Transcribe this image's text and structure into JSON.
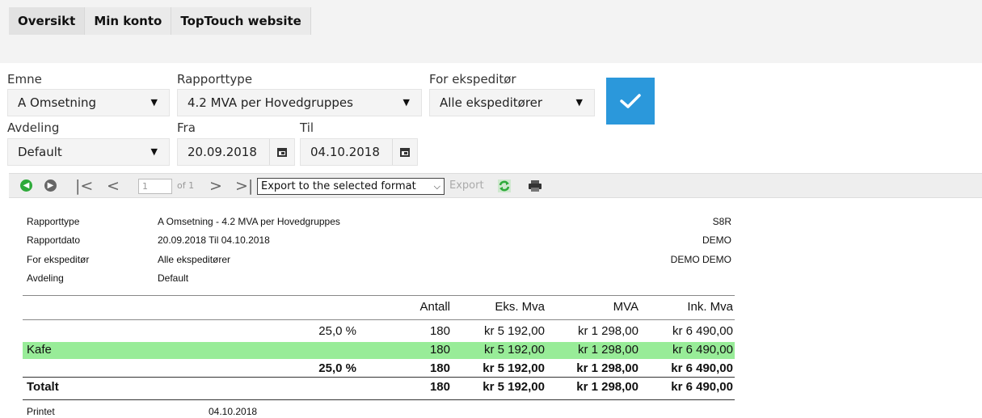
{
  "tabs": [
    "Oversikt",
    "Min konto",
    "TopTouch website"
  ],
  "form": {
    "emne_label": "Emne",
    "emne_value": "A Omsetning",
    "rapporttype_label": "Rapporttype",
    "rapporttype_value": "4.2 MVA per Hovedgruppes",
    "ekspeditor_label": "For ekspeditør",
    "ekspeditor_value": "Alle ekspeditører",
    "avdeling_label": "Avdeling",
    "avdeling_value": "Default",
    "fra_label": "Fra",
    "fra_value": "20.09.2018",
    "til_label": "Til",
    "til_value": "04.10.2018"
  },
  "toolbar": {
    "page_value": "1",
    "of_pages": "of 1",
    "export_format": "Export to the selected format",
    "export_label": "Export"
  },
  "report": {
    "info": [
      {
        "label": "Rapporttype",
        "value": "A Omsetning - 4.2 MVA per Hovedgruppes",
        "right": "S8R"
      },
      {
        "label": "Rapportdato",
        "value": "20.09.2018 Til 04.10.2018",
        "right": "DEMO"
      },
      {
        "label": "For ekspeditør",
        "value": "Alle ekspeditører",
        "right": "DEMO DEMO"
      },
      {
        "label": "Avdeling",
        "value": "Default",
        "right": ""
      }
    ],
    "columns": [
      "Antall",
      "Eks. Mva",
      "MVA",
      "Ink. Mva"
    ],
    "rows": [
      {
        "name": "",
        "rate": "25,0 %",
        "antall": "180",
        "eks": "kr 5 192,00",
        "mva": "kr 1 298,00",
        "ink": "kr 6 490,00"
      },
      {
        "name": "Kafe",
        "rate": "",
        "antall": "180",
        "eks": "kr 5 192,00",
        "mva": "kr 1 298,00",
        "ink": "kr 6 490,00"
      },
      {
        "name": "",
        "rate": "25,0 %",
        "antall": "180",
        "eks": "kr 5 192,00",
        "mva": "kr 1 298,00",
        "ink": "kr 6 490,00"
      },
      {
        "name": "Totalt",
        "rate": "",
        "antall": "180",
        "eks": "kr 5 192,00",
        "mva": "kr 1 298,00",
        "ink": "kr 6 490,00"
      }
    ],
    "printed_label": "Printet",
    "printed_value": "04.10.2018"
  },
  "colors": {
    "accent": "#2b98db",
    "highlight_row": "#98ec98"
  }
}
